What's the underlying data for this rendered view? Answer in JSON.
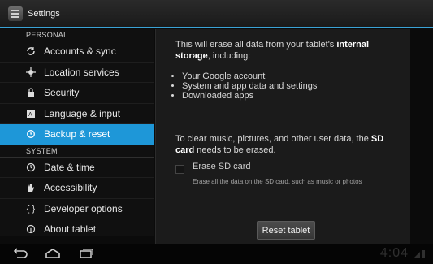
{
  "window": {
    "title": "Settings"
  },
  "sidebar": {
    "sections": [
      {
        "header": "PERSONAL",
        "items": [
          {
            "label": "Accounts & sync",
            "icon": "sync-icon"
          },
          {
            "label": "Location services",
            "icon": "location-icon"
          },
          {
            "label": "Security",
            "icon": "lock-icon"
          },
          {
            "label": "Language & input",
            "icon": "keyboard-icon"
          },
          {
            "label": "Backup & reset",
            "icon": "backup-icon",
            "selected": true
          }
        ]
      },
      {
        "header": "SYSTEM",
        "items": [
          {
            "label": "Date & time",
            "icon": "clock-icon"
          },
          {
            "label": "Accessibility",
            "icon": "hand-icon"
          },
          {
            "label": "Developer options",
            "icon": "braces-icon"
          },
          {
            "label": "About tablet",
            "icon": "info-icon"
          }
        ]
      }
    ]
  },
  "content": {
    "para1_prefix": "This will erase all data from your tablet's ",
    "para1_bold": "internal storage",
    "para1_suffix": ", including:",
    "bullets": [
      "Your Google account",
      "System and app data and settings",
      "Downloaded apps"
    ],
    "para2_prefix": "To clear music, pictures, and other user data, the ",
    "para2_bold": "SD card",
    "para2_suffix": " needs to be erased.",
    "erase_sd_label": "Erase SD card",
    "erase_sd_sub": "Erase all the data on the SD card, such as music or photos",
    "erase_sd_checked": false,
    "reset_button_label": "Reset tablet"
  },
  "navbar": {
    "clock": "4:04"
  },
  "colors": {
    "accent": "#1e97d8",
    "background": "#0b0b0b"
  }
}
